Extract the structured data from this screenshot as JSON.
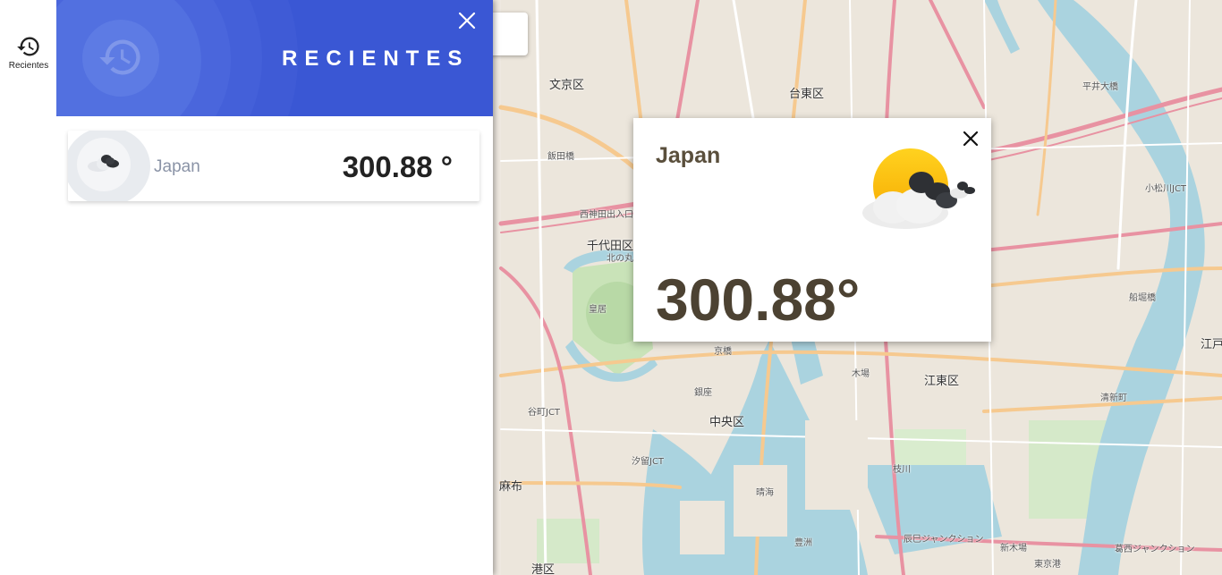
{
  "rail": {
    "recent_label": "Recientes",
    "icon": "history-icon"
  },
  "panel": {
    "title": "RECIENTES",
    "header_icon": "history-icon",
    "close_icon": "close-icon",
    "header_color": "#3a57d4",
    "items": [
      {
        "name": "Japan",
        "temperature": "300.88 °",
        "icon": "broken-clouds-icon"
      }
    ]
  },
  "popup": {
    "name": "Japan",
    "temperature": "300.88°",
    "icon": "partly-cloudy-icon",
    "close_icon": "close-icon"
  },
  "map": {
    "marker_icon": "location-pin-icon",
    "labels": [
      {
        "text": "文京区"
      },
      {
        "text": "台東区"
      },
      {
        "text": "千代田区"
      },
      {
        "text": "北の丸"
      },
      {
        "text": "皇居"
      },
      {
        "text": "中央区"
      },
      {
        "text": "江東区"
      },
      {
        "text": "港区"
      },
      {
        "text": "麻布"
      },
      {
        "text": "晴海"
      },
      {
        "text": "豊洲"
      },
      {
        "text": "銀座"
      },
      {
        "text": "京橋"
      },
      {
        "text": "木場"
      },
      {
        "text": "飯田橋"
      },
      {
        "text": "平井大橋"
      },
      {
        "text": "船堀橋"
      },
      {
        "text": "江戸"
      },
      {
        "text": "東京港"
      },
      {
        "text": "辰巳ジャンクション"
      },
      {
        "text": "葛西ジャンクション"
      },
      {
        "text": "清新町"
      },
      {
        "text": "小松川JCT"
      },
      {
        "text": "西神田出入口"
      },
      {
        "text": "谷町JCT"
      },
      {
        "text": "汐留JCT"
      },
      {
        "text": "枝川"
      },
      {
        "text": "新木場"
      }
    ]
  }
}
